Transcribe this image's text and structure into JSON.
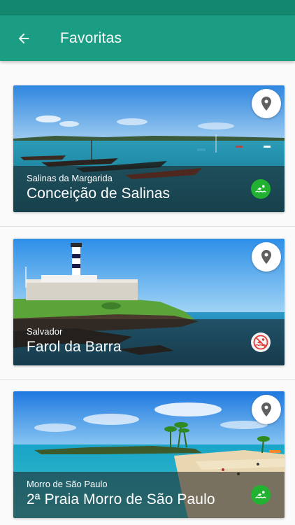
{
  "app_bar": {
    "title": "Favoritas",
    "back_icon": "arrow-left-icon",
    "color": "#1a9d82",
    "status_color": "#14876f"
  },
  "favorites": [
    {
      "city": "Salinas da Margarida",
      "name": "Conceição de Salinas",
      "swim_status": "allowed",
      "swim_icon": "swimmer-icon",
      "pin_icon": "map-pin-icon"
    },
    {
      "city": "Salvador",
      "name": "Farol da Barra",
      "swim_status": "not-allowed",
      "swim_icon": "no-swimming-icon",
      "pin_icon": "map-pin-icon"
    },
    {
      "city": "Morro de São Paulo",
      "name": "2ª Praia Morro de São Paulo",
      "swim_status": "allowed",
      "swim_icon": "swimmer-icon",
      "pin_icon": "map-pin-icon"
    }
  ],
  "colors": {
    "swim_allowed": "#22b231",
    "swim_forbidden": "#e53935"
  }
}
